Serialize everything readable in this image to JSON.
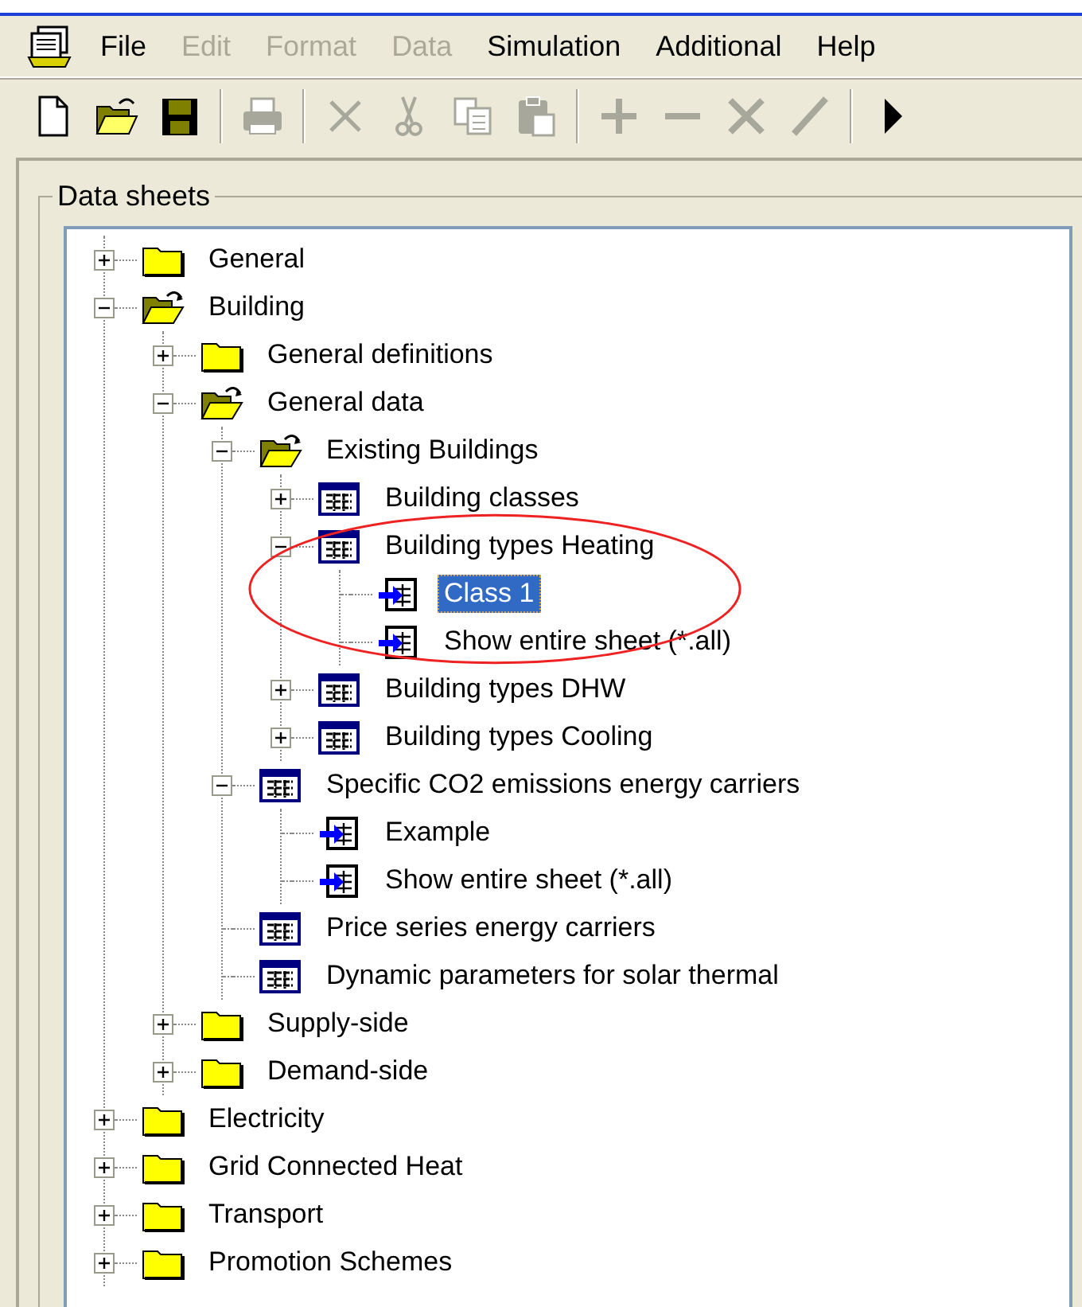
{
  "menu": [
    {
      "label": "File",
      "disabled": false
    },
    {
      "label": "Edit",
      "disabled": true
    },
    {
      "label": "Format",
      "disabled": true
    },
    {
      "label": "Data",
      "disabled": true
    },
    {
      "label": "Simulation",
      "disabled": false
    },
    {
      "label": "Additional",
      "disabled": false
    },
    {
      "label": "Help",
      "disabled": false
    }
  ],
  "toolbar": [
    {
      "kind": "new",
      "disabled": false
    },
    {
      "kind": "open",
      "disabled": false
    },
    {
      "kind": "save",
      "disabled": false
    },
    {
      "kind": "separator"
    },
    {
      "kind": "print",
      "disabled": true
    },
    {
      "kind": "separator"
    },
    {
      "kind": "delete",
      "disabled": true
    },
    {
      "kind": "cut",
      "disabled": true
    },
    {
      "kind": "copy",
      "disabled": true
    },
    {
      "kind": "paste",
      "disabled": true
    },
    {
      "kind": "separator"
    },
    {
      "kind": "plus",
      "disabled": true
    },
    {
      "kind": "minus",
      "disabled": true
    },
    {
      "kind": "cross",
      "disabled": true
    },
    {
      "kind": "slash",
      "disabled": true
    },
    {
      "kind": "separator"
    },
    {
      "kind": "run",
      "disabled": false
    }
  ],
  "panel": {
    "title": "Data sheets"
  },
  "tree": [
    {
      "label": "General",
      "kind": "folder",
      "expanded": false,
      "selected": false
    },
    {
      "label": "Building",
      "kind": "folder",
      "expanded": true,
      "selected": false,
      "children": [
        {
          "label": "General definitions",
          "kind": "folder",
          "expanded": false,
          "selected": false
        },
        {
          "label": "General data",
          "kind": "folder",
          "expanded": true,
          "selected": false,
          "children": [
            {
              "label": "Existing Buildings",
              "kind": "folder",
              "expanded": true,
              "selected": false,
              "children": [
                {
                  "label": "Building classes",
                  "kind": "sheet",
                  "expanded": false,
                  "selected": false
                },
                {
                  "label": "Building types Heating",
                  "kind": "sheet",
                  "expanded": true,
                  "selected": false,
                  "children": [
                    {
                      "label": "Class 1",
                      "kind": "link",
                      "selected": true
                    },
                    {
                      "label": "Show entire sheet (*.all)",
                      "kind": "link",
                      "selected": false
                    }
                  ]
                },
                {
                  "label": "Building types DHW",
                  "kind": "sheet",
                  "expanded": false,
                  "selected": false
                },
                {
                  "label": "Building types Cooling",
                  "kind": "sheet",
                  "expanded": false,
                  "selected": false
                }
              ]
            },
            {
              "label": "Specific CO2 emissions energy carriers",
              "kind": "sheet",
              "expanded": true,
              "selected": false,
              "children": [
                {
                  "label": "Example",
                  "kind": "link",
                  "selected": false
                },
                {
                  "label": "Show entire sheet (*.all)",
                  "kind": "link",
                  "selected": false
                }
              ]
            },
            {
              "label": "Price series energy carriers",
              "kind": "sheet",
              "selected": false
            },
            {
              "label": "Dynamic parameters for solar thermal",
              "kind": "sheet",
              "selected": false
            }
          ]
        },
        {
          "label": "Supply-side",
          "kind": "folder",
          "expanded": false,
          "selected": false
        },
        {
          "label": "Demand-side",
          "kind": "folder",
          "expanded": false,
          "selected": false
        }
      ]
    },
    {
      "label": "Electricity",
      "kind": "folder",
      "expanded": false,
      "selected": false
    },
    {
      "label": "Grid Connected Heat",
      "kind": "folder",
      "expanded": false,
      "selected": false
    },
    {
      "label": "Transport",
      "kind": "folder",
      "expanded": false,
      "selected": false
    },
    {
      "label": "Promotion Schemes",
      "kind": "folder",
      "expanded": false,
      "selected": false
    }
  ]
}
